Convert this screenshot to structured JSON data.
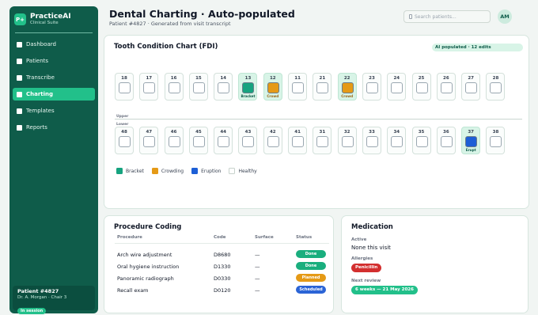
{
  "colors": {
    "sidebar": "#0f5c4a",
    "accent": "#22c08a",
    "bracket": "#16a37f",
    "crowding": "#e59a16",
    "eruption": "#1d5fd6",
    "done": "#1aae7e",
    "planned": "#e59a16",
    "scheduled": "#2b64d6",
    "allergy": "#d32f2f",
    "next_review": "#22c08a"
  },
  "brand": {
    "logo": "P+",
    "name": "PracticeAI",
    "subtitle": "Clinical Suite"
  },
  "nav": [
    {
      "label": "Dashboard",
      "icon": "dashboard-icon",
      "active": false
    },
    {
      "label": "Patients",
      "icon": "patients-icon",
      "active": false
    },
    {
      "label": "Transcribe",
      "icon": "transcribe-icon",
      "active": false
    },
    {
      "label": "Charting",
      "icon": "charting-icon",
      "active": true
    },
    {
      "label": "Templates",
      "icon": "templates-icon",
      "active": false
    },
    {
      "label": "Reports",
      "icon": "reports-icon",
      "active": false
    }
  ],
  "patient_card": {
    "title": "Patient #4827",
    "subtitle": "Dr. A. Morgan · Chair 3",
    "status": "In session"
  },
  "header": {
    "title": "Dental Charting · Auto-populated",
    "subtitle": "Patient #4827 · Generated from visit transcript",
    "search_placeholder": "Search patients...",
    "avatar": "AM"
  },
  "chart": {
    "title": "Tooth Condition Chart (FDI)",
    "ai_badge": "AI populated · 12 edits",
    "upper_label": "Upper",
    "lower_label": "Lower",
    "upper": [
      {
        "num": "18"
      },
      {
        "num": "17"
      },
      {
        "num": "16"
      },
      {
        "num": "15"
      },
      {
        "num": "14"
      },
      {
        "num": "13",
        "condition": "Bracket",
        "kind": "bracket"
      },
      {
        "num": "12",
        "condition": "Crowd",
        "kind": "crowding"
      },
      {
        "num": "11"
      },
      {
        "num": "21"
      },
      {
        "num": "22",
        "condition": "Crowd",
        "kind": "crowding"
      },
      {
        "num": "23"
      },
      {
        "num": "24"
      },
      {
        "num": "25"
      },
      {
        "num": "26"
      },
      {
        "num": "27"
      },
      {
        "num": "28"
      }
    ],
    "lower": [
      {
        "num": "48"
      },
      {
        "num": "47"
      },
      {
        "num": "46"
      },
      {
        "num": "45"
      },
      {
        "num": "44"
      },
      {
        "num": "43"
      },
      {
        "num": "42"
      },
      {
        "num": "41"
      },
      {
        "num": "31"
      },
      {
        "num": "32"
      },
      {
        "num": "33"
      },
      {
        "num": "34"
      },
      {
        "num": "35"
      },
      {
        "num": "36"
      },
      {
        "num": "37",
        "condition": "Erupt",
        "kind": "eruption"
      },
      {
        "num": "38"
      }
    ],
    "legend": [
      {
        "label": "Bracket",
        "kind": "bracket"
      },
      {
        "label": "Crowding",
        "kind": "crowding"
      },
      {
        "label": "Eruption",
        "kind": "eruption"
      },
      {
        "label": "Healthy",
        "kind": "healthy"
      }
    ]
  },
  "procedures": {
    "title": "Procedure Coding",
    "headers": {
      "procedure": "Procedure",
      "code": "Code",
      "surface": "Surface",
      "status": "Status"
    },
    "rows": [
      {
        "procedure": "Arch wire adjustment",
        "code": "D8680",
        "surface": "—",
        "status": "Done",
        "kind": "done"
      },
      {
        "procedure": "Oral hygiene instruction",
        "code": "D1330",
        "surface": "—",
        "status": "Done",
        "kind": "done"
      },
      {
        "procedure": "Panoramic radiograph",
        "code": "D0330",
        "surface": "—",
        "status": "Planned",
        "kind": "planned"
      },
      {
        "procedure": "Recall exam",
        "code": "D0120",
        "surface": "—",
        "status": "Scheduled",
        "kind": "scheduled"
      }
    ]
  },
  "medication": {
    "title": "Medication",
    "active_label": "Active",
    "active_value": "None this visit",
    "allergies_label": "Allergies",
    "allergy": "Penicillin",
    "next_review_label": "Next review",
    "next_review": "6 weeks — 21 May 2026"
  }
}
